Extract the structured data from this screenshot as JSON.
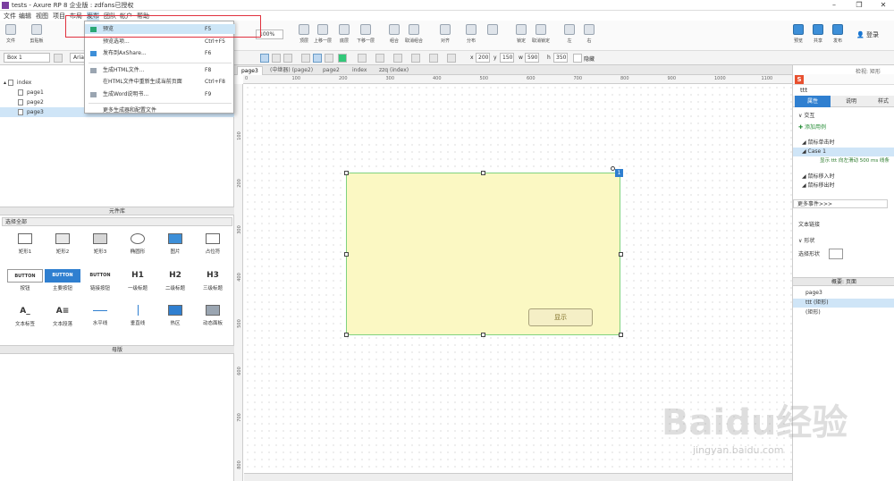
{
  "window": {
    "title": "tests - Axure RP 8 企业版 : zdfans已授权"
  },
  "menubar": {
    "items": [
      "文件",
      "编辑",
      "视图",
      "项目",
      "布局",
      "发布",
      "团队",
      "帐户",
      "帮助"
    ]
  },
  "toolbar": {
    "left": [
      {
        "label": "文件",
        "icon": "new-file-icon"
      },
      {
        "label": "剪贴板",
        "icon": "clipboard-icon"
      }
    ],
    "zoom": "100%",
    "tools": [
      "顶层",
      "上移一层",
      "底层",
      "下移一层",
      "组合",
      "取消组合",
      "对齐",
      "分布",
      "锁定",
      "取消锁定",
      "左",
      "右"
    ],
    "right": [
      {
        "label": "预览",
        "icon": "preview-icon"
      },
      {
        "label": "共享",
        "icon": "share-icon"
      },
      {
        "label": "发布",
        "icon": "publish-icon"
      }
    ],
    "login": "登录"
  },
  "formatbar": {
    "style_select": "Box 1",
    "font_select": "Arial",
    "x_label": "x",
    "x_value": "200",
    "y_label": "y",
    "y_value": "150",
    "w_label": "w",
    "w_value": "590",
    "h_label": "h",
    "h_value": "350",
    "hide_label": "隐藏"
  },
  "pages": {
    "root": "index",
    "children": [
      "page1",
      "page2",
      "page3"
    ],
    "selected": "page3"
  },
  "library": {
    "header": "元件库",
    "select_all": "选择全部",
    "widgets": [
      {
        "label": "矩形1",
        "kind": "rect"
      },
      {
        "label": "矩形2",
        "kind": "rect2"
      },
      {
        "label": "矩形3",
        "kind": "rect3"
      },
      {
        "label": "椭圆形",
        "kind": "ellipse"
      },
      {
        "label": "图片",
        "kind": "image"
      },
      {
        "label": "占位符",
        "kind": "placeholder"
      },
      {
        "label": "按钮",
        "kind": "button",
        "inner": "BUTTON"
      },
      {
        "label": "主要按钮",
        "kind": "primary",
        "inner": "BUTTON"
      },
      {
        "label": "链接按钮",
        "kind": "link",
        "inner": "BUTTON"
      },
      {
        "label": "一级标题",
        "kind": "text",
        "inner": "H1"
      },
      {
        "label": "二级标题",
        "kind": "text",
        "inner": "H2"
      },
      {
        "label": "三级标题",
        "kind": "text",
        "inner": "H3"
      },
      {
        "label": "文本标签",
        "kind": "text",
        "inner": "A_"
      },
      {
        "label": "文本段落",
        "kind": "text",
        "inner": "A≡"
      },
      {
        "label": "水平线",
        "kind": "hline"
      },
      {
        "label": "垂直线",
        "kind": "vline"
      },
      {
        "label": "热区",
        "kind": "hotspot"
      },
      {
        "label": "动态面板",
        "kind": "dynpanel"
      }
    ]
  },
  "masters": {
    "header": "母版"
  },
  "canvas": {
    "tabs": [
      "page3",
      "(中继器) (page2)",
      "page2",
      "index",
      "zzq (index)"
    ],
    "active_tab": "page3",
    "hruler_ticks": [
      "0",
      "100",
      "200",
      "300",
      "400",
      "500",
      "600",
      "700",
      "800",
      "900",
      "1000",
      "1100"
    ],
    "vruler_ticks": [
      "100",
      "200",
      "300",
      "400",
      "500",
      "600",
      "700",
      "800"
    ],
    "button_text": "显示",
    "badge": "1"
  },
  "dropdown": {
    "items": [
      {
        "label": "预览",
        "shortcut": "F5",
        "icon": "preview-icon",
        "highlight": true
      },
      {
        "label": "预览选项...",
        "shortcut": "Ctrl+F5",
        "icon": "",
        "highlight": false
      },
      {
        "label": "发布到AxShare...",
        "shortcut": "F6",
        "icon": "cloud-icon",
        "highlight": false
      },
      {
        "label": "生成HTML文件...",
        "shortcut": "F8",
        "icon": "code-icon",
        "highlight": false
      },
      {
        "label": "在HTML文件中重新生成当前页面",
        "shortcut": "Ctrl+F8",
        "icon": "",
        "highlight": false
      },
      {
        "label": "生成Word说明书...",
        "shortcut": "F9",
        "icon": "word-icon",
        "highlight": false
      },
      {
        "label": "更多生成器和配置文件",
        "shortcut": "",
        "icon": "",
        "highlight": false
      }
    ]
  },
  "right": {
    "header": "检视: 矩形",
    "name_field": "ttt",
    "tabs": [
      "属性",
      "说明",
      "样式"
    ],
    "interaction": "交互",
    "add_case": "添加用例",
    "event_click": "鼠标单击时",
    "case1": "Case 1",
    "action": "显示 ttt 向左滑动 500 ms 线条",
    "event_enter": "鼠标移入时",
    "event_leave": "鼠标移出时",
    "more_events": "更多事件>>>",
    "text_link": "文本链接",
    "shape": "形状",
    "select_shape": "选择形状",
    "outline_header": "概要: 页面",
    "outline_page": "page3",
    "outline_item1": "ttt (矩形)",
    "outline_item2": "(矩形)"
  },
  "watermark": {
    "text": "Baidu经验",
    "url": "jingyan.baidu.com"
  }
}
